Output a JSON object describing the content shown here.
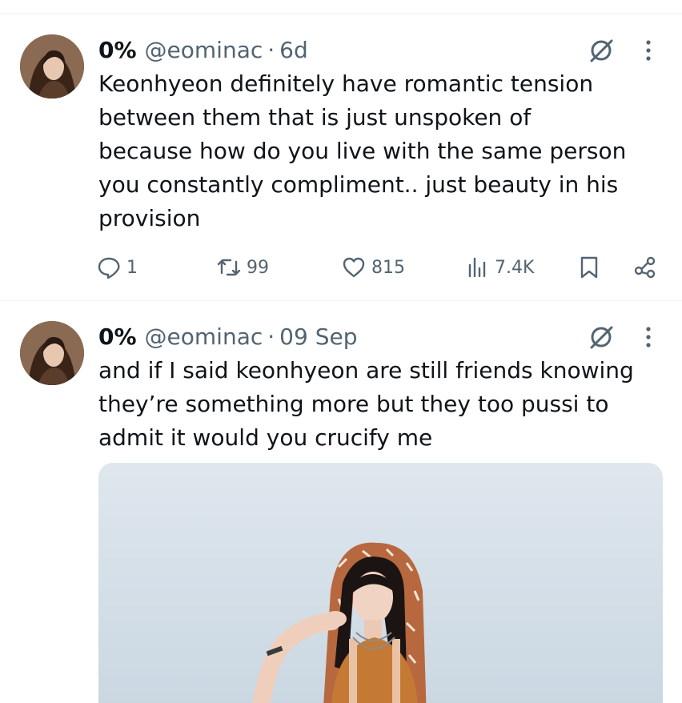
{
  "colors": {
    "text": "#0f1419",
    "secondary": "#536471",
    "divider": "#eff3f4",
    "media_bg": "#d9e2ea"
  },
  "tweets": [
    {
      "author_name": "0%",
      "handle": "@eominac",
      "separator": "·",
      "time": "6d",
      "text": "Keonhyeon definitely have romantic tension\nbetween them that is just unspoken of\nbecause how do you live with the same person\nyou constantly compliment.. just beauty in his\nprovision",
      "replies": "1",
      "retweets": "99",
      "likes": "815",
      "views": "7.4K",
      "icons": [
        "grok-icon",
        "more-icon",
        "reply-icon",
        "retweet-icon",
        "like-icon",
        "views-icon",
        "bookmark-icon",
        "share-icon"
      ]
    },
    {
      "author_name": "0%",
      "handle": "@eominac",
      "separator": "·",
      "time": "09 Sep",
      "text": "and if I said keonhyeon are still friends knowing\nthey’re something more but they too pussi to\nadmit it would you crucify me",
      "icons": [
        "grok-icon",
        "more-icon"
      ]
    }
  ]
}
